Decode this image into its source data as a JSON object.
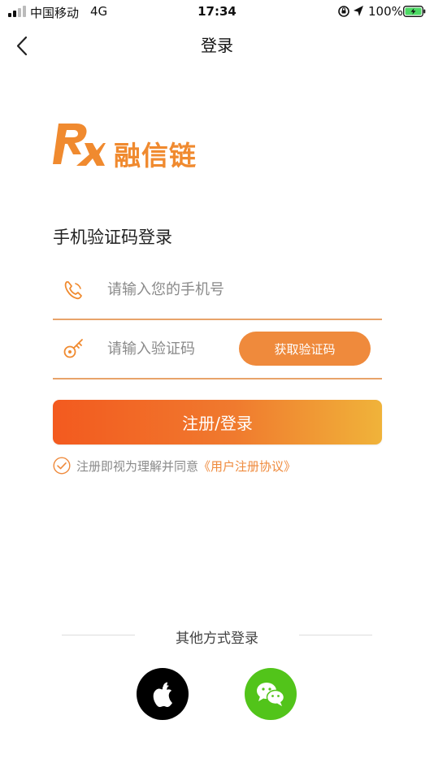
{
  "status_bar": {
    "carrier": "中国移动",
    "network": "4G",
    "time": "17:34",
    "battery_percent": "100%"
  },
  "nav": {
    "title": "登录",
    "back_icon": "chevron-left-icon"
  },
  "logo": {
    "mark_text": "RX",
    "text": "融信链",
    "color": "#f08a2f"
  },
  "login_form": {
    "title": "手机验证码登录",
    "phone": {
      "placeholder": "请输入您的手机号",
      "value": "",
      "icon": "phone-icon"
    },
    "code": {
      "placeholder": "请输入验证码",
      "value": "",
      "icon": "key-icon"
    },
    "get_code_label": "获取验证码",
    "submit_label": "注册/登录",
    "agreement_prefix": "注册即视为理解并同意",
    "agreement_link": "《用户注册协议》"
  },
  "other_login": {
    "label": "其他方式登录",
    "providers": [
      {
        "name": "apple",
        "icon": "apple-icon"
      },
      {
        "name": "wechat",
        "icon": "wechat-icon"
      }
    ]
  },
  "colors": {
    "accent": "#ef8a3c",
    "gradient_start": "#f35a1f",
    "gradient_end": "#f0b33a",
    "wechat": "#52c41a"
  }
}
